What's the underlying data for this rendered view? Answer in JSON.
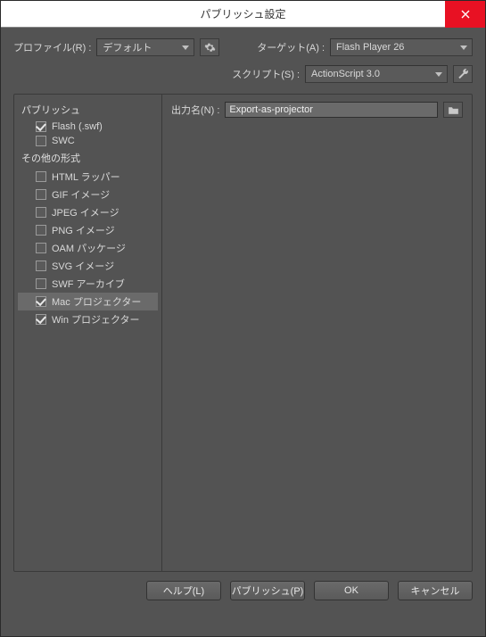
{
  "window": {
    "title": "パブリッシュ設定"
  },
  "header": {
    "profile_label": "プロファイル(R) :",
    "profile_value": "デフォルト",
    "target_label": "ターゲット(A) :",
    "target_value": "Flash Player 26",
    "script_label": "スクリプト(S) :",
    "script_value": "ActionScript 3.0"
  },
  "sidebar": {
    "cat_publish": "パブリッシュ",
    "cat_other": "その他の形式",
    "items": [
      {
        "label": "Flash (.swf)",
        "checked": true
      },
      {
        "label": "SWC",
        "checked": false
      },
      {
        "label": "HTML ラッパー",
        "checked": false
      },
      {
        "label": "GIF イメージ",
        "checked": false
      },
      {
        "label": "JPEG イメージ",
        "checked": false
      },
      {
        "label": "PNG イメージ",
        "checked": false
      },
      {
        "label": "OAM パッケージ",
        "checked": false
      },
      {
        "label": "SVG イメージ",
        "checked": false
      },
      {
        "label": "SWF アーカイブ",
        "checked": false
      },
      {
        "label": "Mac プロジェクター",
        "checked": true
      },
      {
        "label": "Win プロジェクター",
        "checked": true
      }
    ]
  },
  "main": {
    "output_label": "出力名(N) :",
    "output_value": "Export-as-projector"
  },
  "footer": {
    "help": "ヘルプ(L)",
    "publish": "パブリッシュ(P)",
    "ok": "OK",
    "cancel": "キャンセル"
  }
}
